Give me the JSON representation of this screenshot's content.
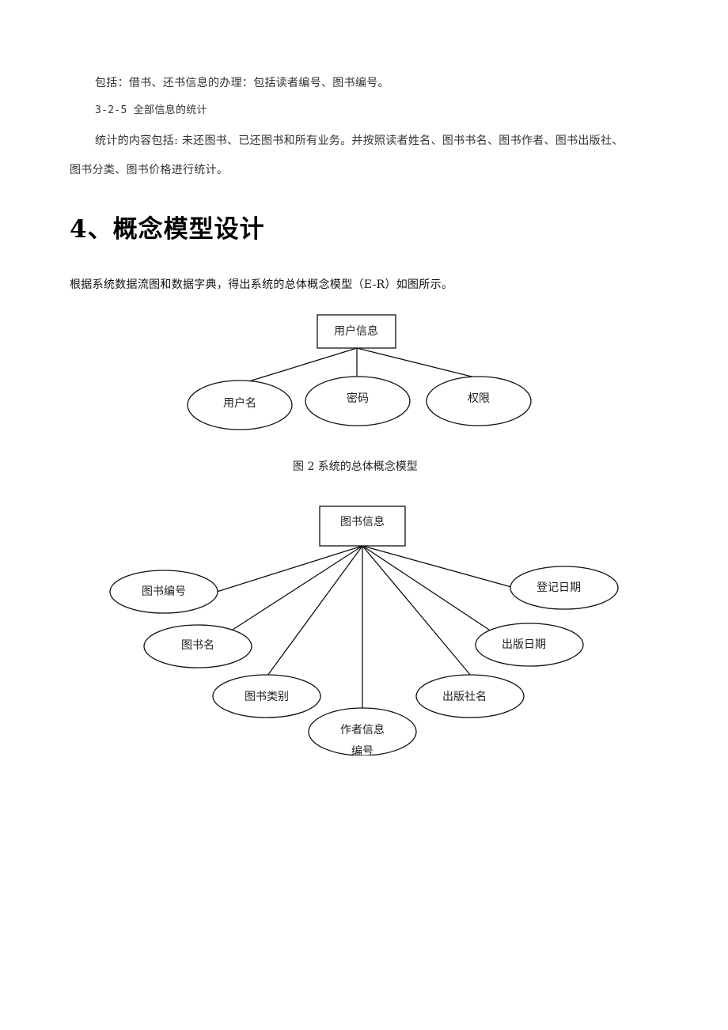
{
  "document": {
    "paragraphs": {
      "p1": "包括：借书、还书信息的办理：包括读者编号、图书编号。",
      "p2": "3-2-5 全部信息的统计",
      "p3_line1": "统计的内容包括: 未还图书、已还图书和所有业务。并按照读者姓名、图书书名、图书作者、图书出版社、",
      "p3_line2": "图书分类、图书价格进行统计。"
    },
    "section_heading": "4、概念模型设计",
    "intro": "根据系统数据流图和数据字典，得出系统的总体概念模型（E-R）如图所示。",
    "figure_caption": "图 2  系统的总体概念模型"
  },
  "er_user": {
    "entity": "用户信息",
    "attributes": [
      "用户名",
      "密码",
      "权限"
    ]
  },
  "er_book": {
    "entity": "图书信息",
    "attributes": [
      "图书编号",
      "图书名",
      "图书类别",
      "作者信息",
      "出版社名",
      "出版日期",
      "登记日期"
    ],
    "truncated_text": "编号"
  }
}
